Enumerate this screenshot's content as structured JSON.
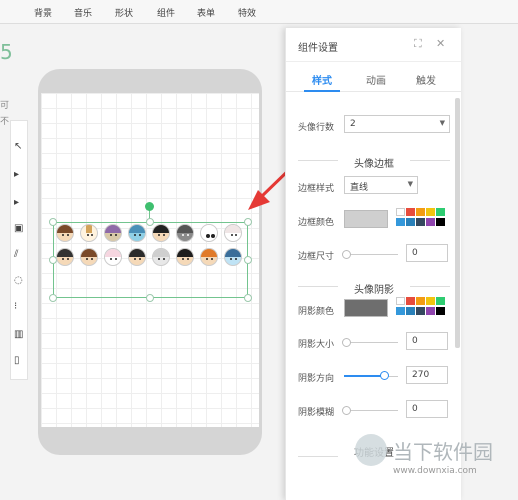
{
  "menu": [
    "背景",
    "音乐",
    "形状",
    "组件",
    "表单",
    "特效"
  ],
  "left_fragments": {
    "number": "5",
    "line1": "可",
    "line2": "不"
  },
  "left_tools": [
    "↖",
    "▸",
    "▸",
    "▣",
    "⫽",
    "◌",
    "⁝",
    "▥",
    "▯"
  ],
  "panel": {
    "title": "组件设置",
    "tabs": [
      "样式",
      "动画",
      "触发"
    ],
    "avatar_rows": {
      "label": "头像行数",
      "value": "2"
    },
    "border_section": "头像边框",
    "border_style": {
      "label": "边框样式",
      "value": "直线"
    },
    "border_color": {
      "label": "边框颜色",
      "value": "#cfcfcf"
    },
    "border_size": {
      "label": "边框尺寸",
      "value": "0"
    },
    "shadow_section": "头像阴影",
    "shadow_color": {
      "label": "阴影颜色",
      "value": "#6e6e6e"
    },
    "shadow_size": {
      "label": "阴影大小",
      "value": "0"
    },
    "shadow_direction": {
      "label": "阴影方向",
      "value": "270"
    },
    "shadow_blur": {
      "label": "阴影模糊",
      "value": "0"
    },
    "function_section": "功能设置"
  },
  "palette_colors": [
    "#ffffff",
    "#e74c3c",
    "#f39c12",
    "#f1c40f",
    "#2ecc71",
    "#3498db",
    "#2980b9",
    "#34495e",
    "#8e44ad",
    "#000000"
  ],
  "accent_color": "#2d8cf0",
  "selection_color": "#73c48f",
  "watermark": {
    "brand": "当下软件园",
    "url": "www.downxia.com"
  }
}
